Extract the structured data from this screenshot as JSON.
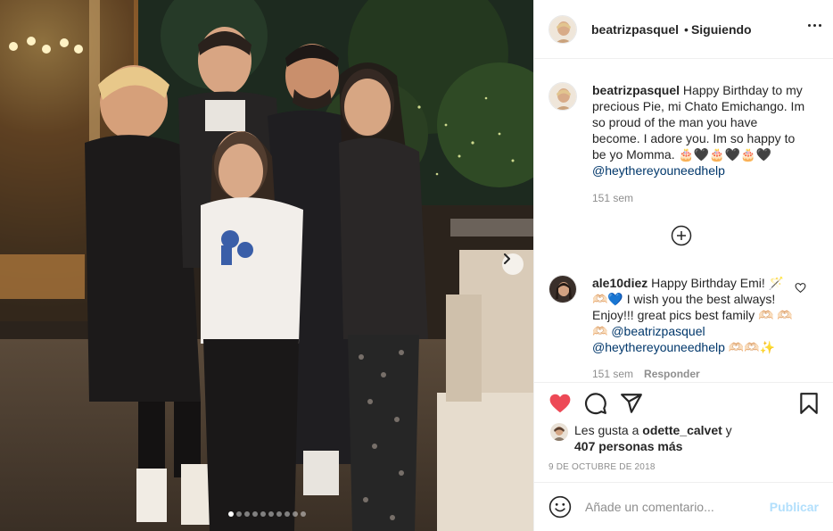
{
  "post": {
    "username": "beatrizpasquel",
    "separator": "•",
    "follow_status": "Siguiendo",
    "carousel_count": 10,
    "carousel_active_index": 0
  },
  "caption": {
    "username": "beatrizpasquel",
    "text": "Happy Birthday to my precious Pie, mi Chato Emichango. Im so proud of the man you have become. I adore you. Im so happy to be yo Momma. 🎂🖤🎂🖤🎂🖤",
    "mention": "@heythereyouneedhelp",
    "time": "151 sem"
  },
  "comment": {
    "username": "ale10diez",
    "text": "Happy Birthday Emi! 🪄 🫶🏻💙 I wish you the best always! Enjoy!!! great pics best family 🫶🏻 🫶🏻🫶🏻",
    "mention1": "@beatrizpasquel",
    "mention2": "@heythereyouneedhelp",
    "trailing": " 🫶🏻🫶🏻✨",
    "time": "151 sem",
    "reply_label": "Responder"
  },
  "likes": {
    "prefix": "Les gusta a ",
    "user": "odette_calvet",
    "connector": " y",
    "others": "407 personas más"
  },
  "date": "9 DE OCTUBRE DE 2018",
  "comment_box": {
    "placeholder": "Añade un comentario...",
    "publish_label": "Publicar"
  },
  "icons": {
    "like": "heart-filled-icon",
    "comment": "comment-bubble-icon",
    "share": "paper-plane-icon",
    "save": "bookmark-icon",
    "more": "more-options-icon",
    "load_more": "plus-circle-icon",
    "next": "chevron-right-icon",
    "emoji": "smiley-icon"
  },
  "colors": {
    "like_red": "#ed4956",
    "mention_blue": "#00376b",
    "publish_disabled": "#b2dffc",
    "muted": "#8e8e8e",
    "border": "#efefef"
  }
}
